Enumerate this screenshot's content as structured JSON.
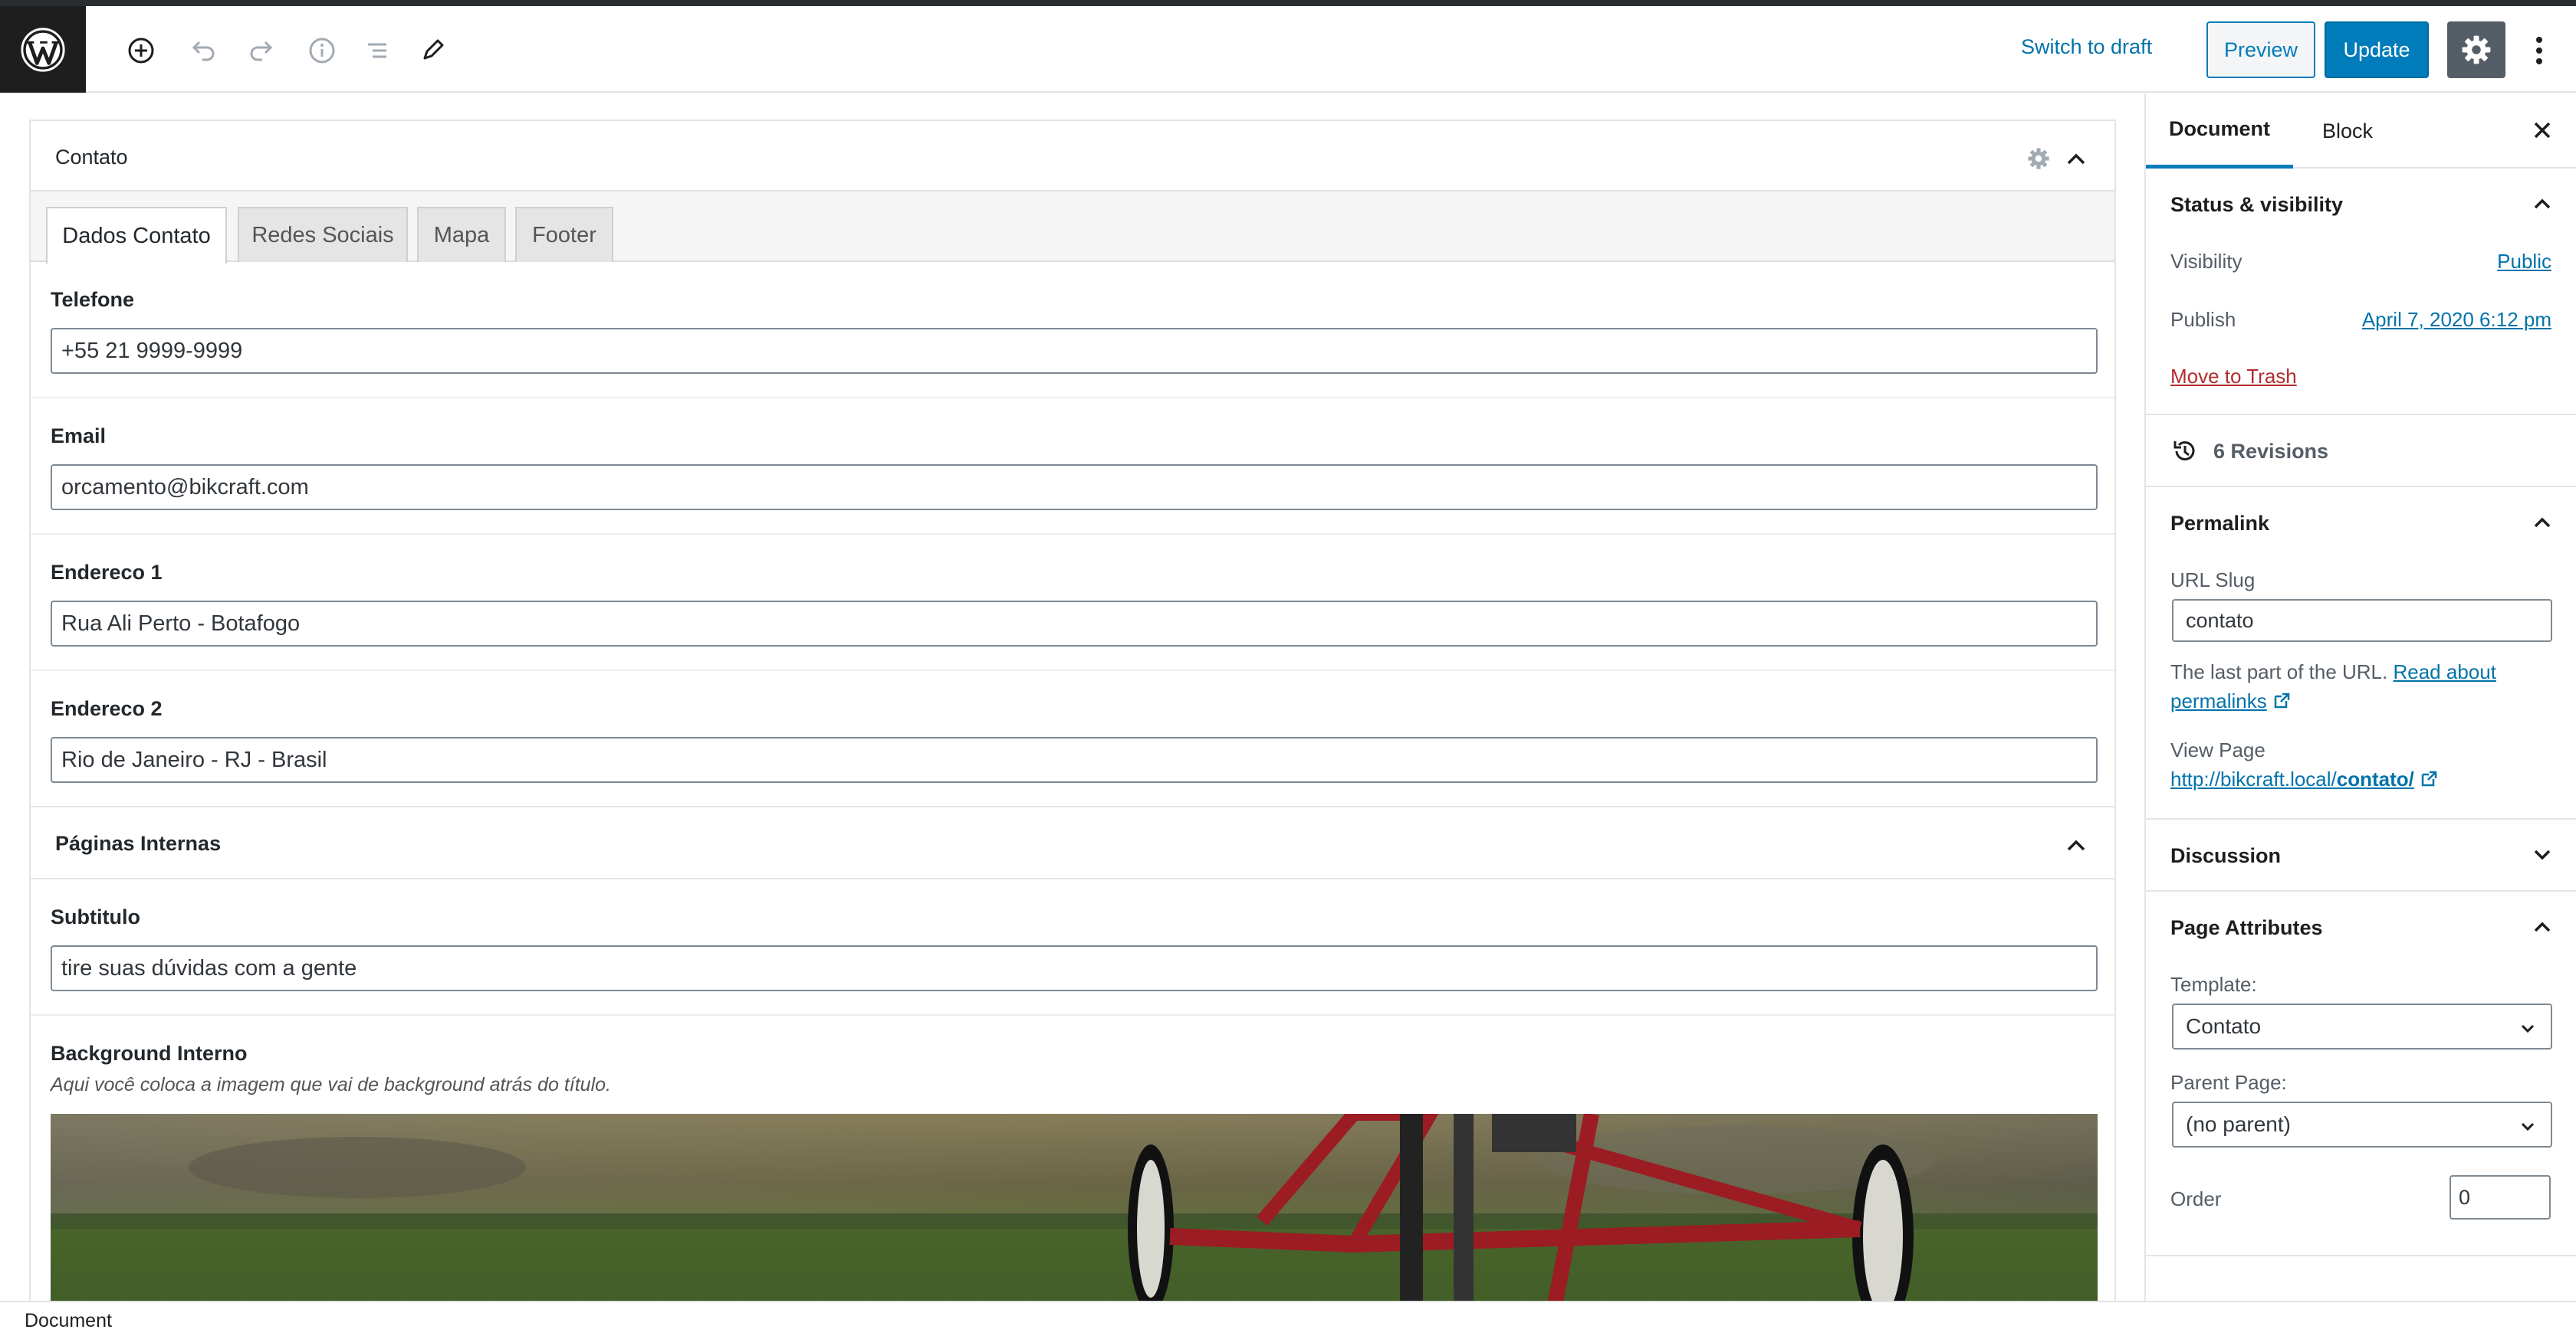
{
  "toolbar": {
    "switch_to_draft": "Switch to draft",
    "preview": "Preview",
    "update": "Update",
    "icons": [
      "wordpress-logo",
      "add-block-icon",
      "undo-icon",
      "redo-icon",
      "info-icon",
      "list-view-icon",
      "edit-icon",
      "gear-icon",
      "more-vertical-icon"
    ]
  },
  "metabox": {
    "title": "Contato",
    "tabs": [
      "Dados Contato",
      "Redes Sociais",
      "Mapa",
      "Footer"
    ],
    "active_tab": "Dados Contato",
    "fields": [
      {
        "label": "Telefone",
        "value": "+55 21 9999-9999"
      },
      {
        "label": "Email",
        "value": "orcamento@bikcraft.com"
      },
      {
        "label": "Endereco 1",
        "value": "Rua Ali Perto - Botafogo"
      },
      {
        "label": "Endereco 2",
        "value": "Rio de Janeiro - RJ - Brasil"
      }
    ]
  },
  "paginas_internas": {
    "title": "Páginas Internas",
    "subtitulo_label": "Subtitulo",
    "subtitulo_value": "tire suas dúvidas com a gente",
    "background_label": "Background Interno",
    "background_desc": "Aqui você coloca a imagem que vai de background atrás do título."
  },
  "sidebar": {
    "tab_document": "Document",
    "tab_block": "Block",
    "status": {
      "title": "Status & visibility",
      "visibility_label": "Visibility",
      "visibility_value": "Public",
      "publish_label": "Publish",
      "publish_value": "April 7, 2020 6:12 pm",
      "trash": "Move to Trash"
    },
    "revisions": "6 Revisions",
    "permalink": {
      "title": "Permalink",
      "slug_label": "URL Slug",
      "slug_value": "contato",
      "help_text": "The last part of the URL.",
      "help_link": "Read about permalinks",
      "view_label": "View Page",
      "view_url_base": "http://bikcraft.local/",
      "view_url_slug": "contato/"
    },
    "discussion": "Discussion",
    "page_attributes": {
      "title": "Page Attributes",
      "template_label": "Template:",
      "template_value": "Contato",
      "parent_label": "Parent Page:",
      "parent_value": "(no parent)",
      "order_label": "Order",
      "order_value": "0"
    }
  },
  "footer": {
    "breadcrumb": "Document"
  },
  "colors": {
    "accent": "#007cba",
    "link": "#0073aa",
    "danger": "#b32d2e"
  }
}
